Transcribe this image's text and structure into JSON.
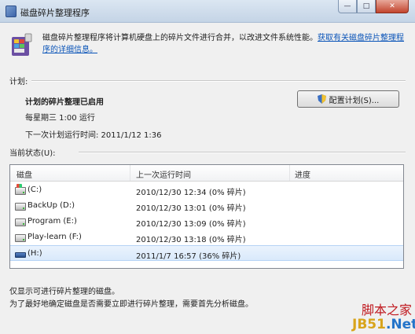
{
  "window": {
    "title": "磁盘碎片整理程序",
    "controls": {
      "minimize_icon": "minimize-icon",
      "maximize_icon": "maximize-icon",
      "close_icon": "close-icon"
    }
  },
  "intro": {
    "text": "磁盘碎片整理程序将计算机硬盘上的碎片文件进行合并，以改进文件系统性能。",
    "link": "获取有关磁盘碎片整理程序的详细信息。"
  },
  "schedule": {
    "group_label": "计划:",
    "status": "计划的碎片整理已启用",
    "when": "每星期三  1:00 运行",
    "next_run": "下一次计划运行时间: 2011/1/12 1:36",
    "configure_button": "配置计划(S)..."
  },
  "current_status": {
    "group_label": "当前状态(U):",
    "columns": [
      "磁盘",
      "上一次运行时间",
      "进度"
    ],
    "rows": [
      {
        "disk": "(C:)",
        "last_run": "2010/12/30 12:34 (0% 碎片)",
        "progress": "",
        "icon": "system-drive-icon"
      },
      {
        "disk": "BackUp (D:)",
        "last_run": "2010/12/30 13:01 (0% 碎片)",
        "progress": "",
        "icon": "drive-icon"
      },
      {
        "disk": "Program (E:)",
        "last_run": "2010/12/30 13:09 (0% 碎片)",
        "progress": "",
        "icon": "drive-icon"
      },
      {
        "disk": "Play-learn (F:)",
        "last_run": "2010/12/30 13:18 (0% 碎片)",
        "progress": "",
        "icon": "drive-icon"
      },
      {
        "disk": "(H:)",
        "last_run": "2011/1/7 16:57 (36% 碎片)",
        "progress": "",
        "icon": "removable-drive-icon"
      }
    ]
  },
  "footer": {
    "line1": "仅显示可进行碎片整理的磁盘。",
    "line2": "为了最好地确定磁盘是否需要立即进行碎片整理，需要首先分析磁盘。"
  },
  "watermark": {
    "line1": "脚本之家",
    "line2_main": "JB51",
    "line2_suffix": ".Net"
  }
}
